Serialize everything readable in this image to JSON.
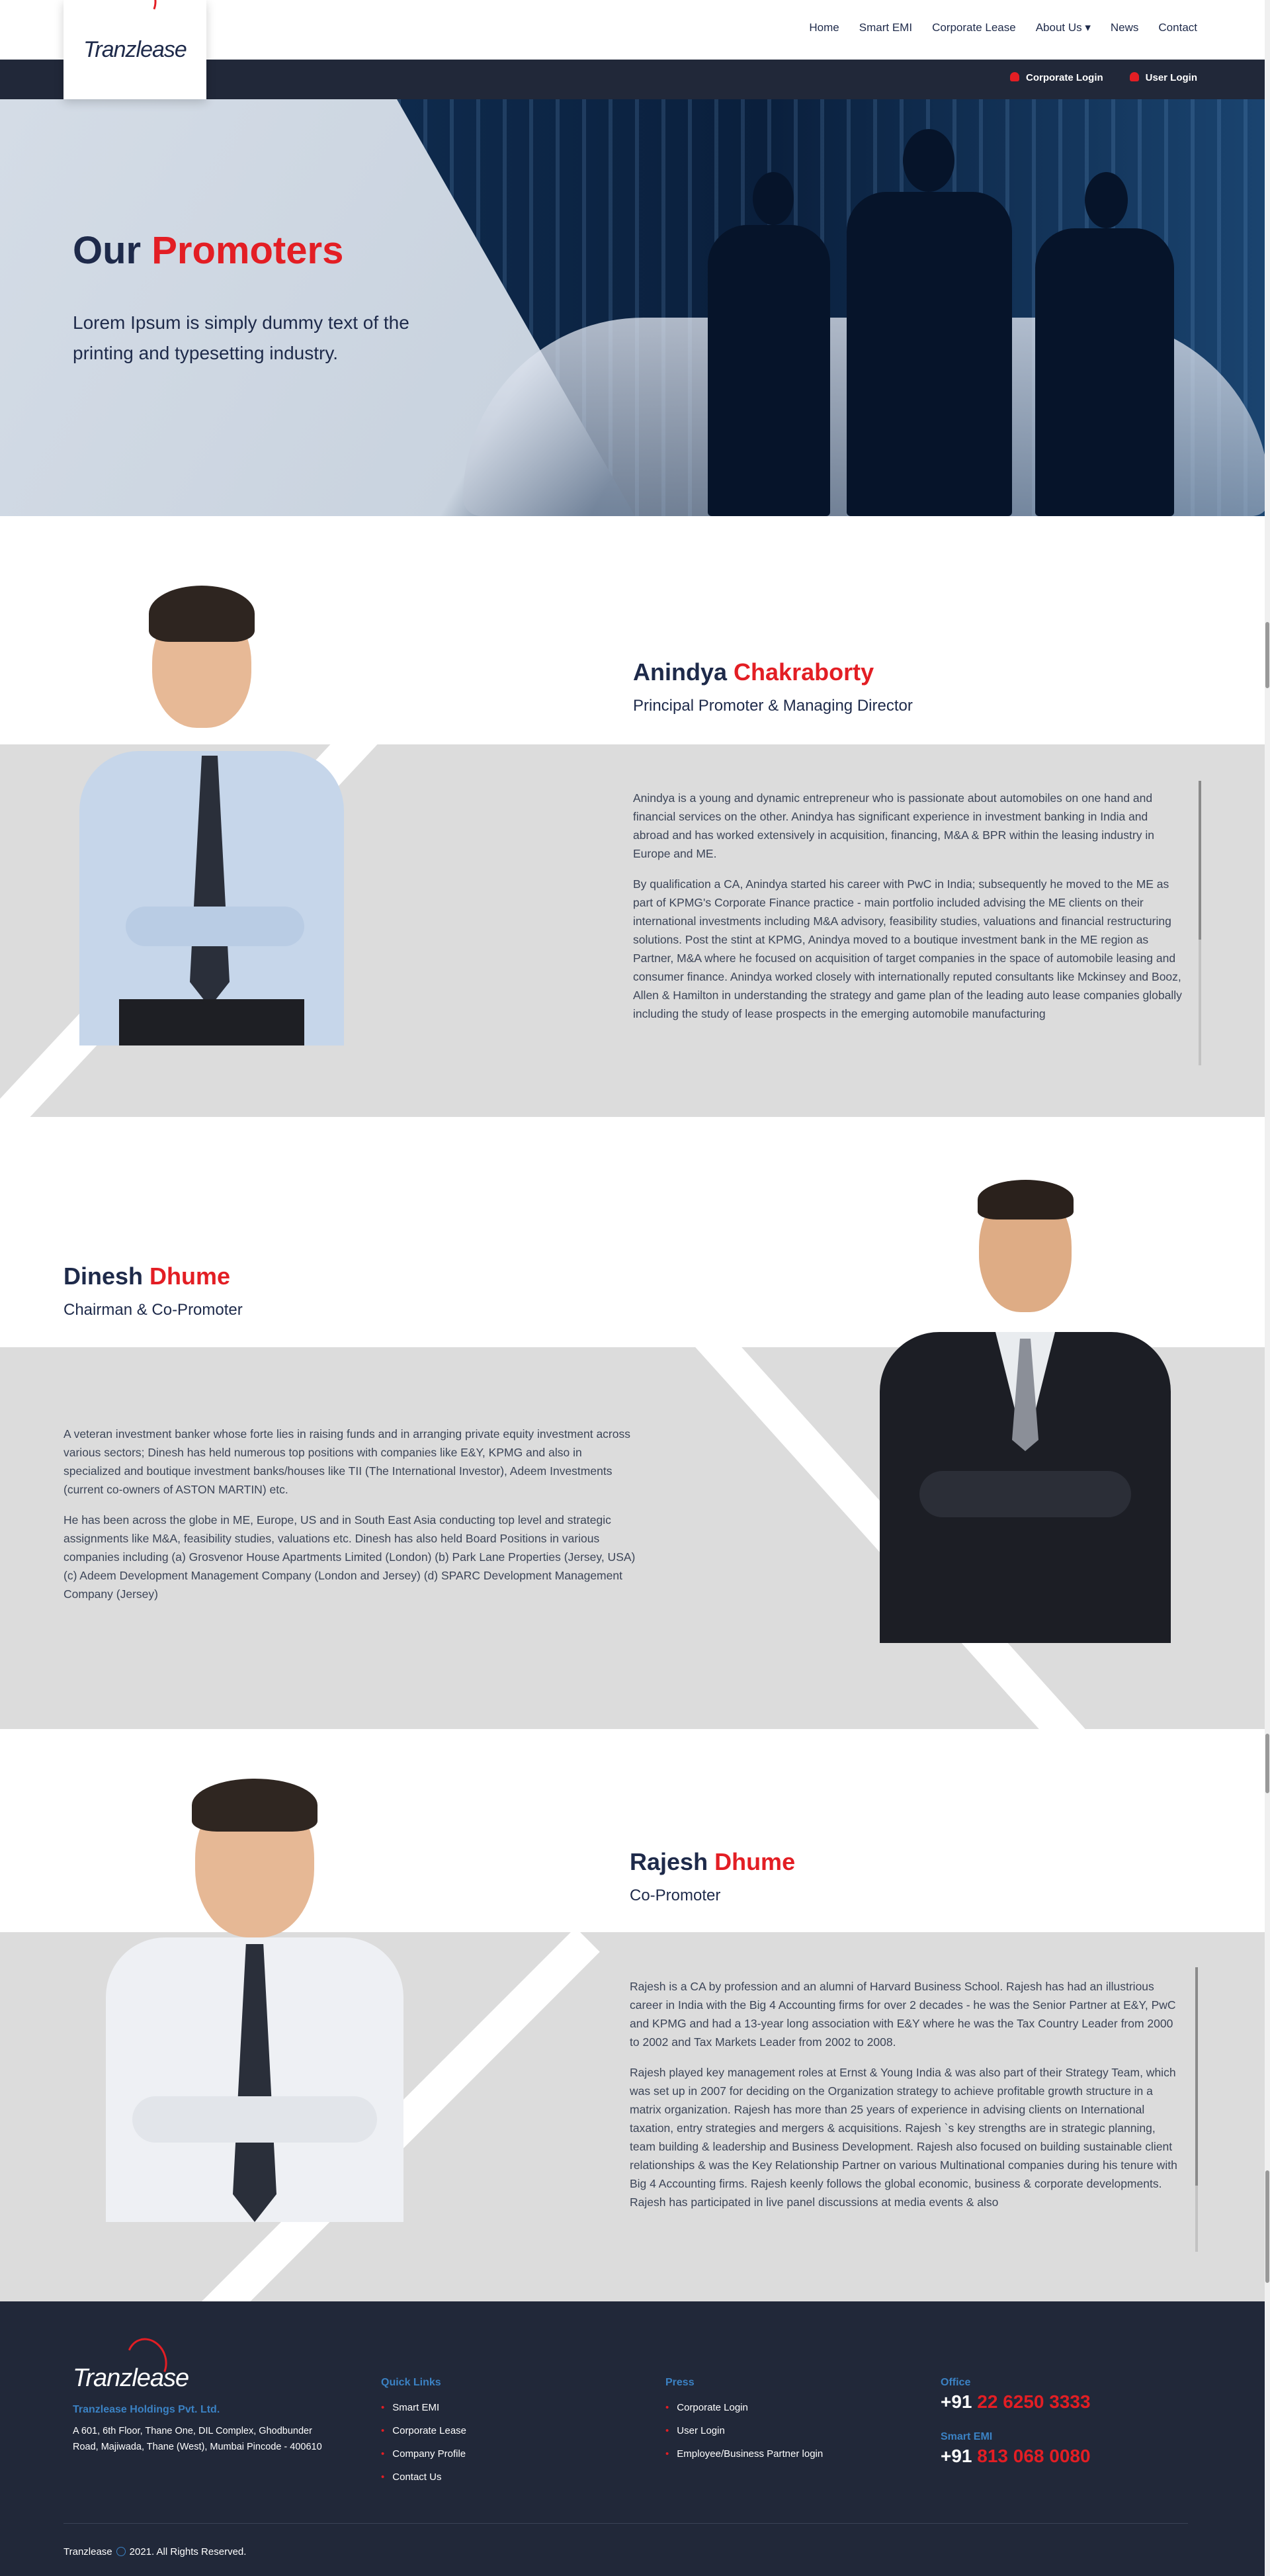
{
  "logo": {
    "text": "Tranzlease"
  },
  "nav": {
    "items": [
      "Home",
      "Smart EMI",
      "Corporate Lease",
      "About Us ▾",
      "News",
      "Contact"
    ]
  },
  "topbar": {
    "corporate_login": "Corporate Login",
    "user_login": "User Login"
  },
  "hero": {
    "title_a": "Our",
    "title_b": "Promoters",
    "subtitle": "Lorem Ipsum is simply dummy text of the printing and typesetting industry."
  },
  "promoters": [
    {
      "first": "Anindya",
      "last": "Chakraborty",
      "role": "Principal Promoter & Managing Director",
      "bio": [
        "Anindya is a young and dynamic entrepreneur who is passionate about automobiles on one hand and financial services on the other. Anindya has significant experience in investment banking in India and abroad and has worked extensively in acquisition, financing, M&A & BPR within the leasing industry in Europe and ME.",
        "By qualification a CA, Anindya started his career with PwC in India; subsequently he moved to the ME as part of KPMG's Corporate Finance practice - main portfolio included advising the ME clients on their international investments including M&A advisory, feasibility studies, valuations and financial restructuring solutions. Post the stint at KPMG, Anindya moved to a boutique investment bank in the ME region as Partner, M&A where he focused on acquisition of target companies in the space of automobile leasing and consumer finance. Anindya worked closely with internationally reputed consultants like Mckinsey and Booz, Allen & Hamilton in understanding the strategy and game plan of the leading auto lease companies globally including the study of lease prospects in the emerging automobile manufacturing"
      ]
    },
    {
      "first": "Dinesh",
      "last": "Dhume",
      "role": "Chairman & Co-Promoter",
      "bio": [
        "A veteran investment banker whose forte lies in raising funds and in arranging private equity investment across various sectors; Dinesh has held numerous top positions with companies like E&Y, KPMG and also in specialized and boutique investment banks/houses like TII (The International Investor), Adeem Investments (current co-owners of ASTON MARTIN) etc.",
        "He has been across the globe in ME, Europe, US and in South East Asia conducting top level and strategic assignments like M&A, feasibility studies, valuations etc. Dinesh has also held Board Positions in various companies including (a) Grosvenor House Apartments Limited (London) (b) Park Lane Properties (Jersey, USA) (c) Adeem Development Management Company (London and Jersey) (d) SPARC Development Management Company (Jersey)"
      ]
    },
    {
      "first": "Rajesh",
      "last": "Dhume",
      "role": "Co-Promoter",
      "bio": [
        "Rajesh is a CA by profession and an alumni of Harvard Business School. Rajesh has had an illustrious career in India with the Big 4 Accounting firms for over 2 decades - he was the Senior Partner at E&Y, PwC and KPMG and had a 13-year long association with E&Y where he was the Tax Country Leader from 2000 to 2002 and Tax Markets Leader from 2002 to 2008.",
        "Rajesh played key management roles at Ernst & Young India & was also part of their Strategy Team, which was set up in 2007 for deciding on the Organization strategy to achieve profitable growth structure in a matrix organization. Rajesh has more than 25 years of experience in advising clients on International taxation, entry strategies and mergers & acquisitions. Rajesh `s key strengths are in strategic planning, team building & leadership and Business Development. Rajesh also focused on building sustainable client relationships & was the Key Relationship Partner on various Multinational companies during his tenure with Big 4 Accounting firms. Rajesh keenly follows the global economic, business & corporate developments. Rajesh has participated in live panel discussions at media events & also"
      ]
    }
  ],
  "footer": {
    "company": "Tranzlease Holdings Pvt. Ltd.",
    "address": "A 601, 6th Floor, Thane One, DIL Complex, Ghodbunder Road, Majiwada, Thane (West), Mumbai Pincode - 400610",
    "quick_links_title": "Quick Links",
    "quick_links": [
      "Smart EMI",
      "Corporate Lease",
      "Company Profile",
      "Contact Us"
    ],
    "press_title": "Press",
    "press_links": [
      "Corporate Login",
      "User Login",
      "Employee/Business Partner login"
    ],
    "office_label": "Office",
    "office_prefix": "+91",
    "office_number": "22 6250 3333",
    "smartemi_label": "Smart EMI",
    "smartemi_prefix": "+91",
    "smartemi_number": "813 068 0080",
    "copy_brand": "Tranzlease",
    "copy_rest": "2021. All Rights Reserved."
  },
  "colors": {
    "accent": "#e31e24",
    "navy": "#1e2a4a",
    "dark": "#212839",
    "link_blue": "#3b82c4",
    "panel_grey": "#dcdcdc"
  }
}
